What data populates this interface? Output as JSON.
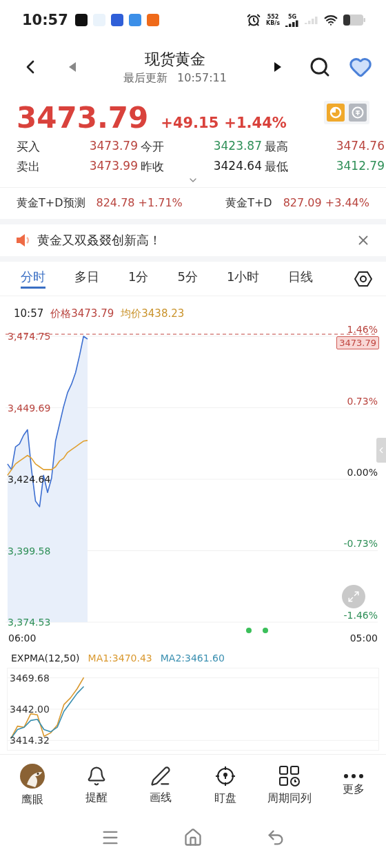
{
  "status_bar": {
    "time": "10:57",
    "speed_value": "552",
    "speed_unit": "KB/s",
    "network": "5G"
  },
  "header": {
    "title": "现货黄金",
    "update_label": "最后更新",
    "update_time": "10:57:11",
    "favorite": true
  },
  "quote": {
    "price": "3473.79",
    "change": "+49.15",
    "change_pct": "+1.44%",
    "stats": [
      {
        "label": "买入",
        "value": "3473.79",
        "color": "#b8433d"
      },
      {
        "label": "今开",
        "value": "3423.87",
        "color": "#2e8f57"
      },
      {
        "label": "最高",
        "value": "3474.76",
        "color": "#b8433d"
      },
      {
        "label": "卖出",
        "value": "3473.99",
        "color": "#b8433d"
      },
      {
        "label": "昨收",
        "value": "3424.64",
        "color": "#1c1c1c"
      },
      {
        "label": "最低",
        "value": "3412.79",
        "color": "#2e8f57"
      }
    ]
  },
  "ticker": [
    {
      "name": "黄金T+D预测",
      "value": "824.78 +1.71%",
      "color": "#b8433d"
    },
    {
      "name": "黄金T+D",
      "value": "827.09 +3.44%",
      "color": "#b8433d"
    }
  ],
  "notice": {
    "text": "黄金又双叒叕创新高！"
  },
  "tabs": [
    {
      "label": "分时",
      "selected": true
    },
    {
      "label": "多日",
      "selected": false
    },
    {
      "label": "1分",
      "selected": false
    },
    {
      "label": "5分",
      "selected": false
    },
    {
      "label": "1小时",
      "selected": false
    },
    {
      "label": "日线",
      "selected": false
    }
  ],
  "chart_info": {
    "time": "10:57",
    "price": "价格3473.79",
    "average": "均价3438.23"
  },
  "main_chart": {
    "price_tag": "3473.79",
    "time_labels": [
      "06:00",
      "05:00"
    ],
    "right_ticks": [
      {
        "label": "1.46%",
        "color": "#b8433d"
      },
      {
        "label": "0.73%",
        "color": "#b8433d"
      },
      {
        "label": "0.00%",
        "color": "#1c1c1c"
      },
      {
        "label": "-0.73%",
        "color": "#2e8f57"
      },
      {
        "label": "-1.46%",
        "color": "#2e8f57"
      }
    ],
    "chart_data": {
      "type": "line",
      "grid": true,
      "categories": [
        null,
        null,
        null,
        null,
        null,
        null,
        null,
        null,
        null,
        null,
        null,
        null,
        null,
        null,
        null,
        null,
        null,
        null,
        null,
        null,
        null,
        null,
        null,
        null,
        null,
        null,
        null,
        null,
        null,
        null,
        null,
        null,
        null,
        null,
        null,
        null,
        null,
        null,
        null,
        null,
        null,
        null,
        null,
        null,
        null,
        null,
        null,
        null,
        null,
        null,
        null,
        null,
        null,
        null,
        null,
        null,
        null,
        null,
        null,
        null,
        null,
        null,
        null,
        null,
        null,
        null,
        null,
        null,
        null,
        null,
        null,
        null,
        null,
        null,
        null,
        null,
        null,
        null,
        null,
        null,
        null,
        null,
        null,
        null,
        null,
        null,
        null,
        null,
        null,
        null,
        null,
        null,
        null
      ],
      "series": [
        {
          "color": "#3d6fd1",
          "values": [
            3430,
            3428,
            3436,
            3437,
            3440,
            3442,
            3428,
            3417,
            3415,
            3426,
            3420,
            3425,
            3438,
            3444,
            3450,
            3455,
            3458,
            3462,
            3468,
            3474.75,
            3473.79,
            null,
            null,
            null,
            null,
            null,
            null,
            null,
            null,
            null,
            null,
            null,
            null,
            null,
            null,
            null,
            null,
            null,
            null,
            null,
            null,
            null,
            null,
            null,
            null,
            null,
            null,
            null,
            null,
            null,
            null,
            null,
            null,
            null,
            null,
            null,
            null,
            null,
            null,
            null,
            null,
            null,
            null,
            null,
            null,
            null,
            null,
            null,
            null,
            null,
            null,
            null,
            null,
            null,
            null,
            null,
            null,
            null,
            null,
            null,
            null,
            null,
            null,
            null,
            null,
            null,
            null,
            null,
            null,
            null,
            null,
            null,
            null
          ]
        },
        {
          "color": "#e0a030",
          "values": [
            3426,
            3428,
            3430,
            3431,
            3432,
            3433,
            3432,
            3430,
            3429,
            3428,
            3428,
            3428,
            3429,
            3431,
            3432,
            3434,
            3435,
            3436,
            3437,
            3438,
            3438.23,
            null,
            null,
            null,
            null,
            null,
            null,
            null,
            null,
            null,
            null,
            null,
            null,
            null,
            null,
            null,
            null,
            null,
            null,
            null,
            null,
            null,
            null,
            null,
            null,
            null,
            null,
            null,
            null,
            null,
            null,
            null,
            null,
            null,
            null,
            null,
            null,
            null,
            null,
            null,
            null,
            null,
            null,
            null,
            null,
            null,
            null,
            null,
            null,
            null,
            null,
            null,
            null,
            null,
            null,
            null,
            null,
            null,
            null,
            null,
            null,
            null,
            null,
            null,
            null,
            null,
            null,
            null,
            null,
            null,
            null,
            null,
            null
          ]
        }
      ],
      "ylim": [
        3374.53,
        3474.75
      ],
      "yticks": [
        {
          "value": 3474.75,
          "label": "3,474.75"
        },
        {
          "value": 3449.69,
          "label": "3,449.69"
        },
        {
          "value": 3424.64,
          "label": "3,424.64"
        },
        {
          "value": 3399.58,
          "label": "3,399.58"
        },
        {
          "value": 3374.53,
          "label": "3,374.53"
        }
      ]
    }
  },
  "indicator": {
    "name": "EXPMA(12,50)",
    "legend": [
      "MA1:3470.43",
      "MA2:3461.60"
    ],
    "chart_data": {
      "type": "line",
      "grid": true,
      "categories": [
        null,
        null,
        null,
        null,
        null,
        null,
        null,
        null,
        null,
        null,
        null,
        null,
        null,
        null,
        null,
        null,
        null,
        null,
        null,
        null,
        null,
        null,
        null,
        null,
        null,
        null,
        null,
        null,
        null,
        null,
        null,
        null,
        null,
        null,
        null,
        null,
        null,
        null,
        null,
        null,
        null,
        null,
        null,
        null,
        null,
        null,
        null,
        null,
        null,
        null,
        null,
        null,
        null,
        null,
        null,
        null
      ],
      "series": [
        {
          "color": "#d9982e",
          "values": [
            3416,
            3427,
            3426,
            3438,
            3437,
            3418,
            3421,
            3428,
            3446,
            3452,
            3460,
            3470,
            null,
            null,
            null,
            null,
            null,
            null,
            null,
            null,
            null,
            null,
            null,
            null,
            null,
            null,
            null,
            null,
            null,
            null,
            null,
            null,
            null,
            null,
            null,
            null,
            null,
            null,
            null,
            null,
            null,
            null,
            null,
            null,
            null,
            null,
            null,
            null,
            null,
            null,
            null,
            null,
            null,
            null,
            null,
            null
          ]
        },
        {
          "color": "#3a8fb0",
          "values": [
            3416,
            3424,
            3426,
            3432,
            3433,
            3424,
            3422,
            3426,
            3440,
            3448,
            3456,
            3462,
            null,
            null,
            null,
            null,
            null,
            null,
            null,
            null,
            null,
            null,
            null,
            null,
            null,
            null,
            null,
            null,
            null,
            null,
            null,
            null,
            null,
            null,
            null,
            null,
            null,
            null,
            null,
            null,
            null,
            null,
            null,
            null,
            null,
            null,
            null,
            null,
            null,
            null,
            null,
            null,
            null,
            null,
            null,
            null
          ]
        }
      ],
      "ylim": [
        3406,
        3478
      ],
      "yticks": [
        {
          "value": 3469.68,
          "label": "3469.68"
        },
        {
          "value": 3442,
          "label": "3442.00"
        },
        {
          "value": 3414.32,
          "label": "3414.32"
        }
      ]
    }
  },
  "toolbar": [
    {
      "label": "鹰眼",
      "kind": "eagle"
    },
    {
      "label": "提醒",
      "kind": "bell"
    },
    {
      "label": "画线",
      "kind": "pencil"
    },
    {
      "label": "盯盘",
      "kind": "target"
    },
    {
      "label": "周期同列",
      "kind": "grid"
    },
    {
      "label": "更多",
      "kind": "more"
    }
  ]
}
